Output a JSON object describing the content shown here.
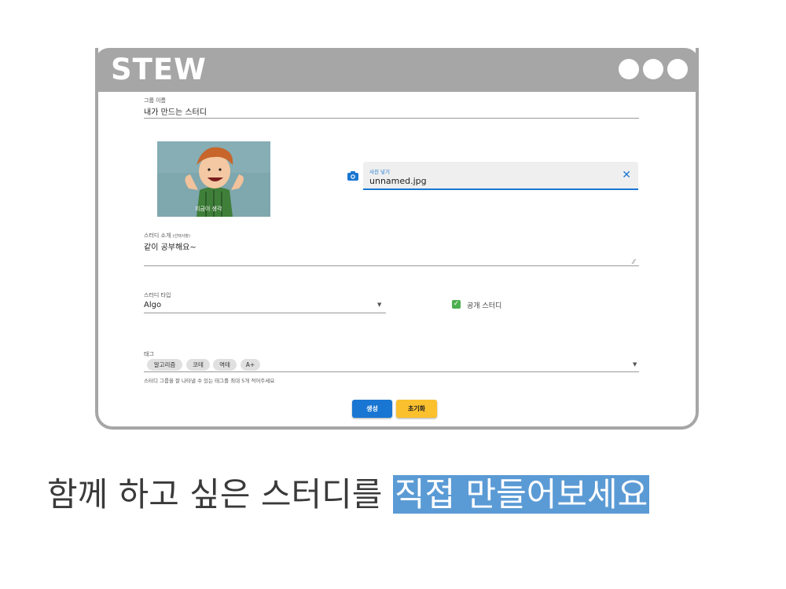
{
  "app": {
    "logo": "STEW",
    "window_dots": 3
  },
  "form": {
    "group_name": {
      "label": "그룹 이름",
      "value": "내가 만드는 스터디"
    },
    "photo": {
      "label": "사진 넣기",
      "value": "unnamed.jpg",
      "icon": "camera-icon",
      "clear_icon": "close-icon",
      "image_overlay_text": "지금이 생각"
    },
    "description": {
      "label": "스터디 소개",
      "label_note": "(선택사항)",
      "value": "같이 공부해요~"
    },
    "study_type": {
      "label": "스터디 타입",
      "value": "Algo"
    },
    "public": {
      "label": "공개 스터디",
      "checked": true
    },
    "tags": {
      "label": "태그",
      "items": [
        "알고리즘",
        "코테",
        "역테",
        "A+"
      ],
      "hint": "스터디 그룹을 잘 나타낼 수 있는 태그를 최대 5개 적어주세요"
    },
    "buttons": {
      "create": "생성",
      "reset": "초기화"
    }
  },
  "caption": {
    "plain": "함께 하고 싶은 스터디를 ",
    "highlight": "직접 만들어보세요"
  },
  "colors": {
    "frame": "#a6a6a6",
    "primary": "#1976d2",
    "warning": "#fbc02d",
    "success": "#4caf50",
    "caption_highlight": "#5b9bd5"
  }
}
